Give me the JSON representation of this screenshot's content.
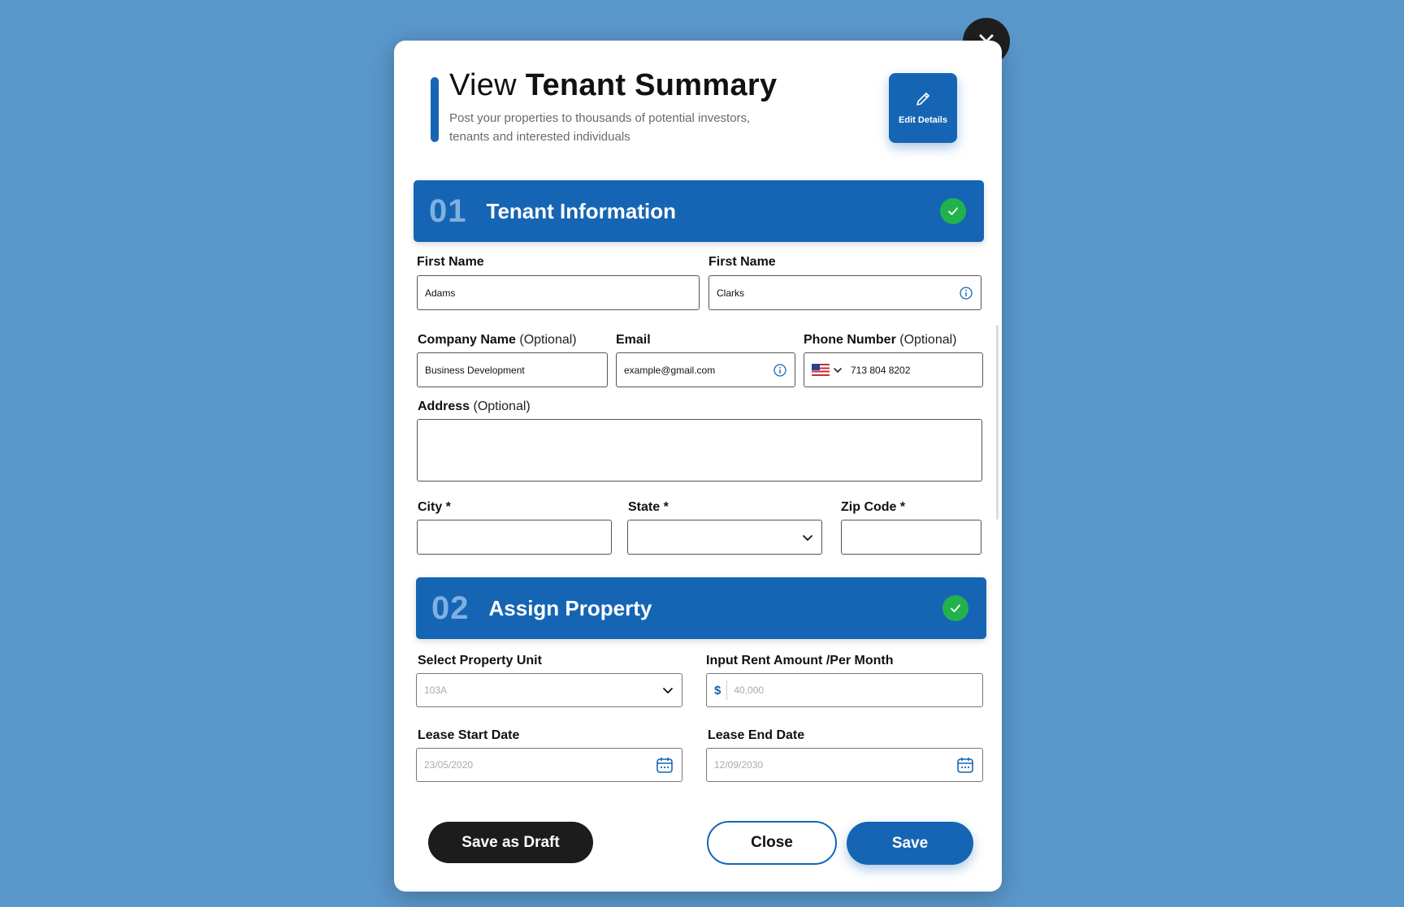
{
  "header": {
    "title_light": "View",
    "title_bold": "Tenant Summary",
    "subtitle": "Post your properties to thousands of potential investors, tenants and interested individuals",
    "edit_label": "Edit Details"
  },
  "section1": {
    "number": "01",
    "title": "Tenant Information",
    "first_name_label": "First Name",
    "first_name_value": "Adams",
    "last_name_label": "First Name",
    "last_name_value": "Clarks",
    "company_label": "Company Name",
    "company_optional": "(Optional)",
    "company_value": "Business Development",
    "email_label": "Email",
    "email_value": "example@gmail.com",
    "phone_label": "Phone Number",
    "phone_optional": "(Optional)",
    "phone_value": "713 804 8202",
    "address_label": "Address",
    "address_optional": "(Optional)",
    "address_value": "",
    "city_label": "City *",
    "city_value": "",
    "state_label": "State  *",
    "state_value": "",
    "zip_label": "Zip Code  *",
    "zip_value": ""
  },
  "section2": {
    "number": "02",
    "title": "Assign Property",
    "unit_label": "Select Property Unit",
    "unit_value": "103A",
    "rent_label": "Input Rent Amount /Per Month",
    "rent_currency": "$",
    "rent_value": "40,000",
    "start_label": "Lease Start Date",
    "start_value": "23/05/2020",
    "end_label": "Lease End Date",
    "end_value": "12/09/2030"
  },
  "footer": {
    "draft_label": "Save as Draft",
    "close_label": "Close",
    "save_label": "Save"
  },
  "colors": {
    "background": "#5a97cb",
    "primary": "#1565b4",
    "success": "#22b24c",
    "dark": "#1c1c1c"
  },
  "icons": [
    "close-icon",
    "pencil-icon",
    "check-icon",
    "info-icon",
    "us-flag-icon",
    "chevron-down-icon",
    "calendar-icon"
  ]
}
